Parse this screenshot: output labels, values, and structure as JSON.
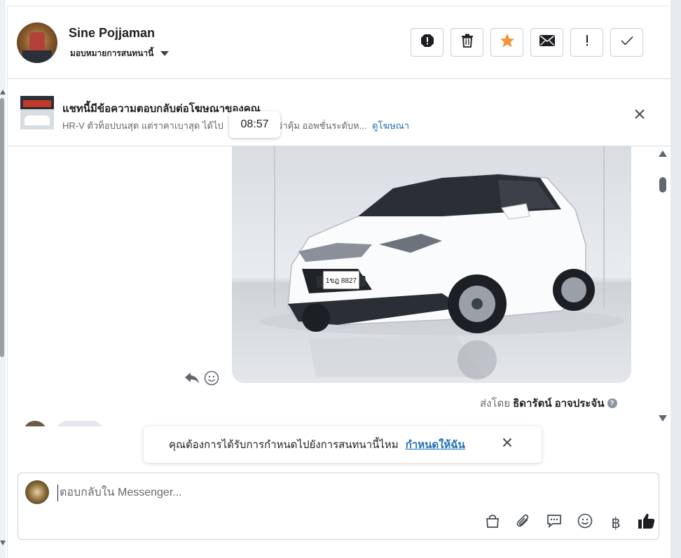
{
  "header": {
    "contact_name": "Sine Pojjaman",
    "assign_label": "มอบหมายการสนทนานี้",
    "actions": [
      {
        "name": "spam-button",
        "icon": "alert-octagon-icon"
      },
      {
        "name": "delete-button",
        "icon": "trash-icon"
      },
      {
        "name": "star-button",
        "icon": "star-icon"
      },
      {
        "name": "mark-unread-button",
        "icon": "envelope-icon"
      },
      {
        "name": "follow-up-button",
        "icon": "exclamation-icon"
      },
      {
        "name": "done-button",
        "icon": "checkmark-icon"
      }
    ]
  },
  "ad_banner": {
    "title": "แชทนี้มีข้อความตอบกลับต่อโฆษณาของคุณ",
    "text": "HR-V ตัวท็อปบนสุด แต่ราคาเบาสุด ได้ไป",
    "text_tail": "ว่าคุ้ม ออพชั่นระดับห...",
    "link": "ดูโฆษณา"
  },
  "tooltip": {
    "time": "08:57"
  },
  "message": {
    "image_plate": "1ขฎ 8827",
    "sent_by_prefix": "ส่งโดย",
    "sent_by_name": "ธิดารัตน์ อาจประจัน",
    "help_glyph": "?"
  },
  "assign_prompt": {
    "text": "คุณต้องการได้รับการกำหนดไปยังการสนทนานี้ไหม",
    "link": "กำหนดให้ฉัน"
  },
  "composer": {
    "placeholder": "ตอบกลับใน Messenger...",
    "baht_glyph": "฿"
  },
  "colors": {
    "accent": "#1d6fb8",
    "star": "#f7923a",
    "border": "#ccd0d5"
  }
}
